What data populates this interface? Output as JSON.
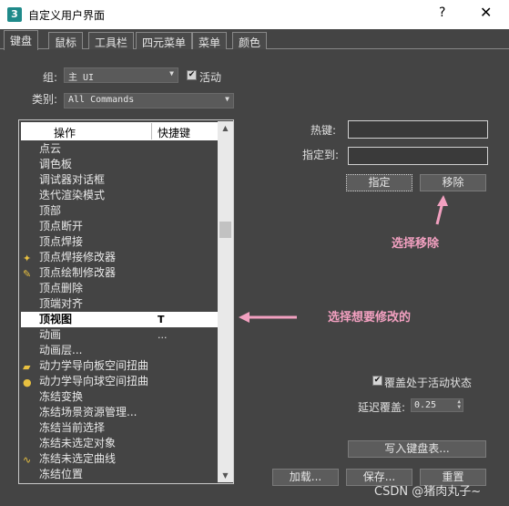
{
  "window": {
    "app_icon_text": "3",
    "title": "自定义用户界面",
    "help": "?",
    "close": "✕"
  },
  "tabs": [
    {
      "label": "键盘",
      "active": true
    },
    {
      "label": "鼠标",
      "active": false
    },
    {
      "label": "工具栏",
      "active": false
    },
    {
      "label": "四元菜单",
      "active": false
    },
    {
      "label": "菜单",
      "active": false
    },
    {
      "label": "颜色",
      "active": false
    }
  ],
  "group": {
    "label": "组:",
    "value": "主 UI",
    "active_checked": true,
    "active_label": "活动"
  },
  "category": {
    "label": "类别:",
    "value": "All Commands"
  },
  "list": {
    "header_action": "操作",
    "header_hotkey": "快捷键",
    "items": [
      {
        "label": "点云",
        "hotkey": "",
        "icon": "",
        "selected": false
      },
      {
        "label": "调色板",
        "hotkey": "",
        "icon": "",
        "selected": false
      },
      {
        "label": "调试器对话框",
        "hotkey": "",
        "icon": "",
        "selected": false
      },
      {
        "label": "迭代渲染模式",
        "hotkey": "",
        "icon": "",
        "selected": false
      },
      {
        "label": "顶部",
        "hotkey": "",
        "icon": "",
        "selected": false
      },
      {
        "label": "顶点断开",
        "hotkey": "",
        "icon": "",
        "selected": false
      },
      {
        "label": "顶点焊接",
        "hotkey": "",
        "icon": "",
        "selected": false
      },
      {
        "label": "顶点焊接修改器",
        "hotkey": "",
        "icon": "wand-icon",
        "selected": false
      },
      {
        "label": "顶点绘制修改器",
        "hotkey": "",
        "icon": "brush-icon",
        "selected": false
      },
      {
        "label": "顶点删除",
        "hotkey": "",
        "icon": "",
        "selected": false
      },
      {
        "label": "顶端对齐",
        "hotkey": "",
        "icon": "",
        "selected": false
      },
      {
        "label": "顶视图",
        "hotkey": "T",
        "icon": "",
        "selected": true
      },
      {
        "label": "动画",
        "hotkey": "...",
        "icon": "",
        "selected": false
      },
      {
        "label": "动画层...",
        "hotkey": "",
        "icon": "",
        "selected": false
      },
      {
        "label": "动力学导向板空间扭曲",
        "hotkey": "",
        "icon": "plate-icon",
        "selected": false
      },
      {
        "label": "动力学导向球空间扭曲",
        "hotkey": "",
        "icon": "sphere-icon",
        "selected": false
      },
      {
        "label": "冻结变换",
        "hotkey": "",
        "icon": "",
        "selected": false
      },
      {
        "label": "冻结场景资源管理...",
        "hotkey": "",
        "icon": "",
        "selected": false
      },
      {
        "label": "冻结当前选择",
        "hotkey": "",
        "icon": "",
        "selected": false
      },
      {
        "label": "冻结未选定对象",
        "hotkey": "",
        "icon": "",
        "selected": false
      },
      {
        "label": "冻结未选定曲线",
        "hotkey": "",
        "icon": "curve-icon",
        "selected": false
      },
      {
        "label": "冻结位置",
        "hotkey": "",
        "icon": "",
        "selected": false
      }
    ]
  },
  "hotkey_label": "热键:",
  "assign_to_label": "指定到:",
  "assign_button": "指定",
  "remove_button": "移除",
  "annotation_remove": "选择移除",
  "annotation_select": "选择想要修改的",
  "override": {
    "checked": true,
    "label": "覆盖处于活动状态"
  },
  "delay": {
    "label": "延迟覆盖:",
    "value": "0.25"
  },
  "write_keyboard_button": "写入键盘表...",
  "load_button": "加载...",
  "save_button": "保存...",
  "reset_button": "重置",
  "watermark": "CSDN @猪肉丸子~"
}
